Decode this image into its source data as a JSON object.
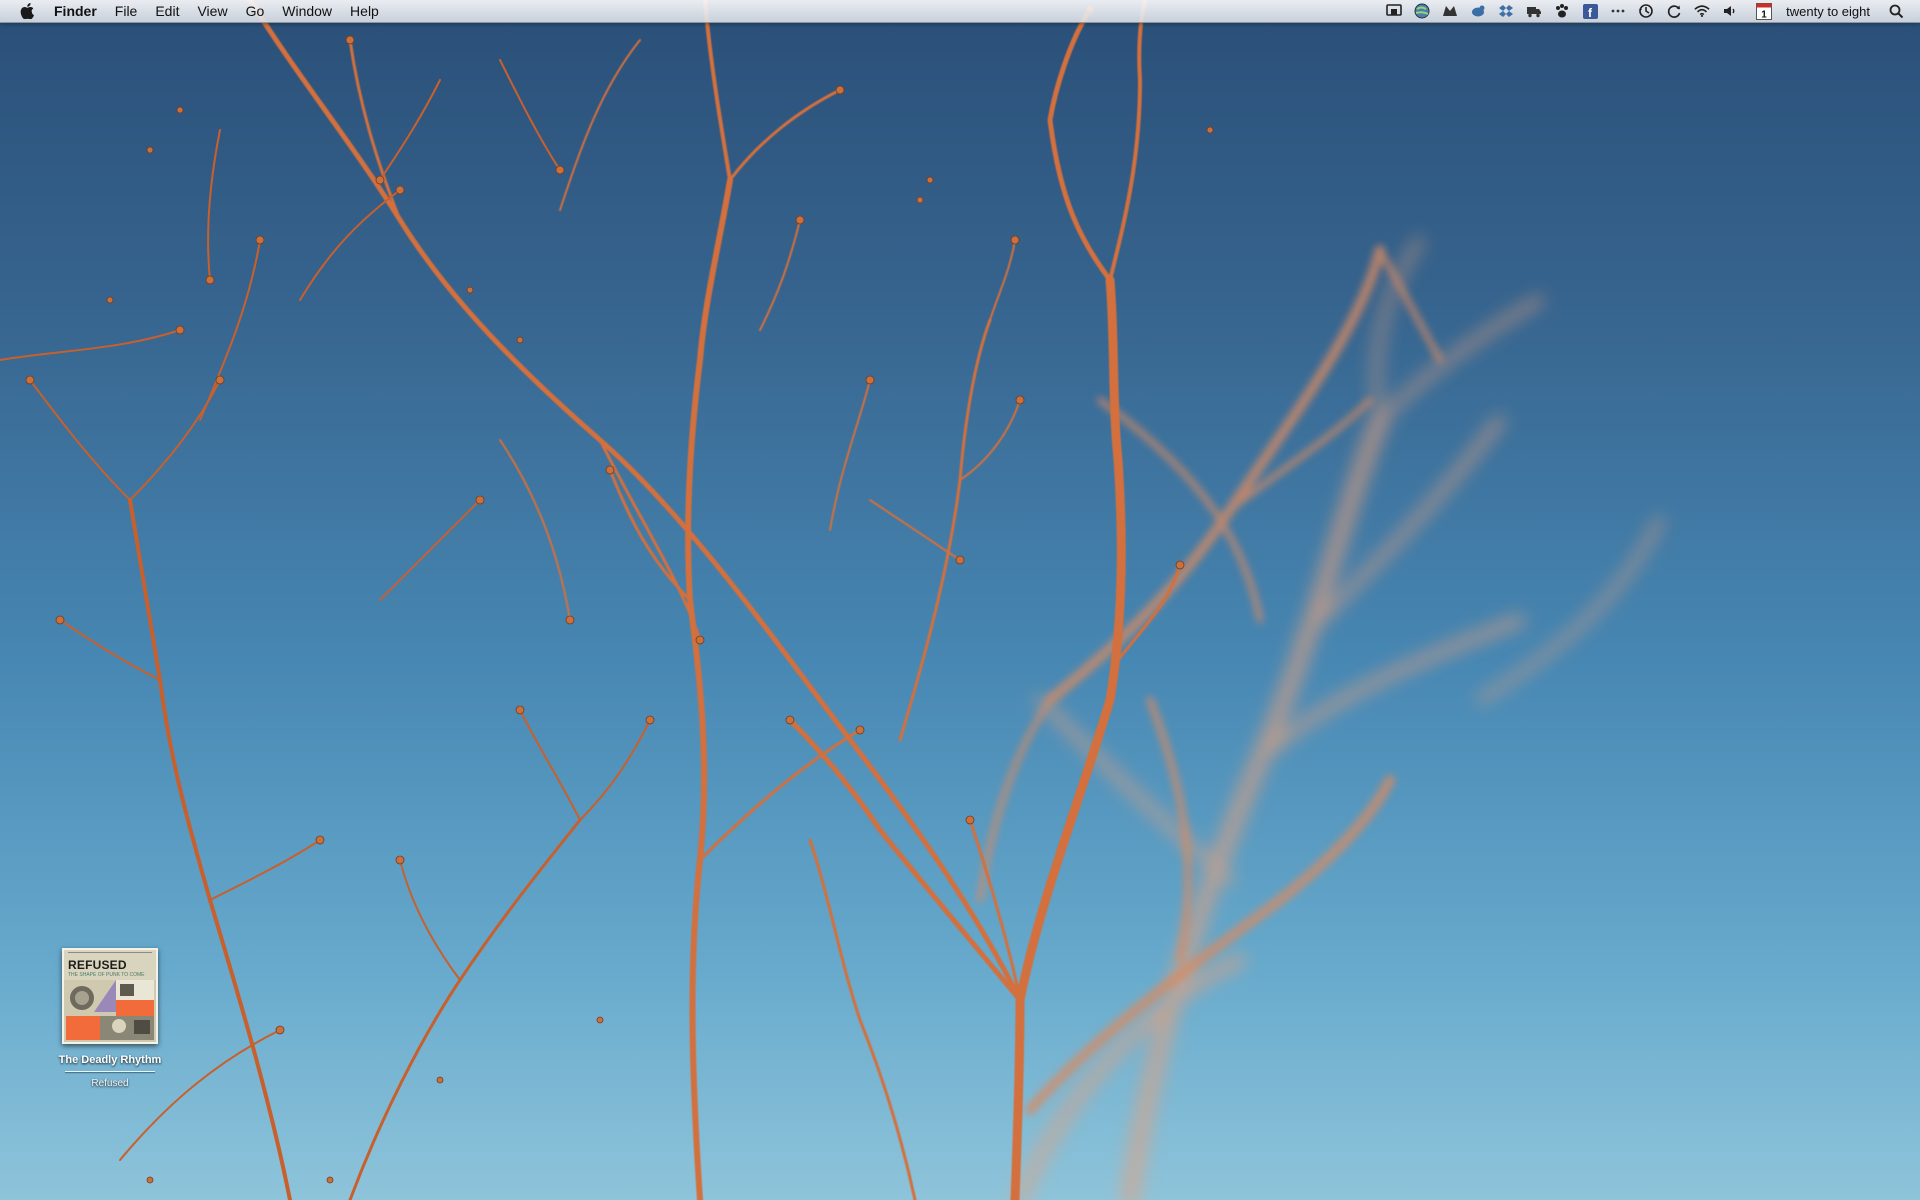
{
  "menubar": {
    "app_name": "Finder",
    "menus": [
      "File",
      "Edit",
      "View",
      "Go",
      "Window",
      "Help"
    ],
    "status_icons": [
      "airport-display-icon",
      "globe-icon",
      "growl-paw-icon",
      "twitter-bird-icon",
      "dropbox-icon",
      "truck-delivery-icon",
      "paw-icon",
      "facebook-icon",
      "ellipsis-icon",
      "time-machine-icon",
      "sync-icon",
      "wifi-icon",
      "volume-icon",
      "calendar-icon"
    ],
    "calendar_day": "1",
    "facebook_glyph": "f",
    "clock": "twenty to eight"
  },
  "desktop_icon": {
    "name": "The Deadly Rhythm",
    "artist": "Refused",
    "album_cover_title": "REFUSED",
    "album_cover_subtitle": "THE SHAPE OF PUNK TO COME"
  },
  "colors": {
    "sky_top": "#2a4f78",
    "sky_bottom": "#8ec4da",
    "branch": "#d4723a",
    "menubar": "#e6e9ee"
  }
}
